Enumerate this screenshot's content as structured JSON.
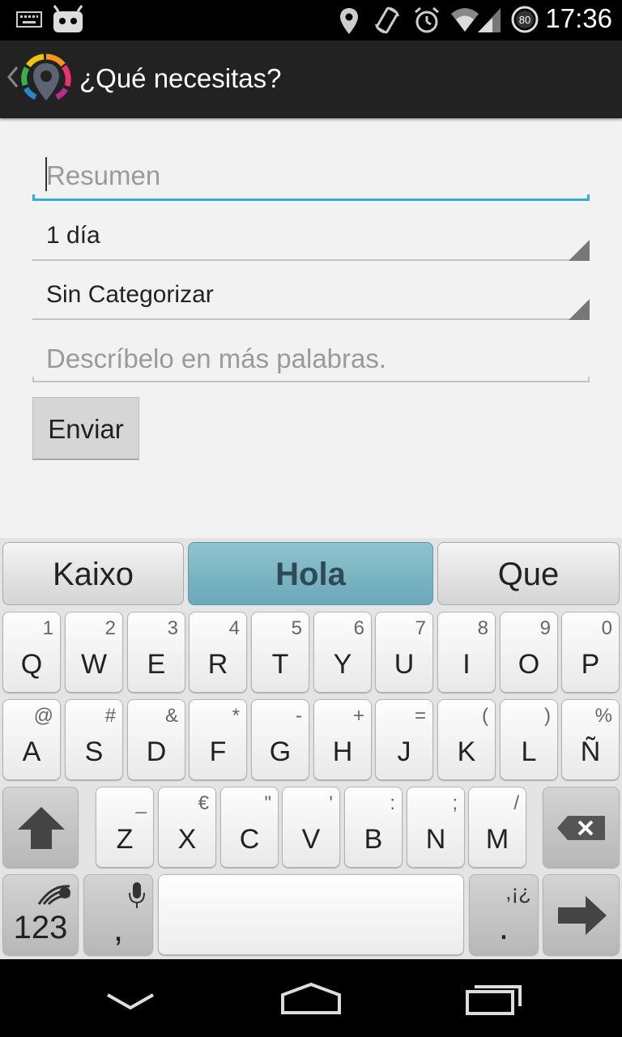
{
  "status_bar": {
    "time": "17:36",
    "battery_level": "80",
    "icons": [
      "keyboard-icon",
      "android-icon",
      "location-icon",
      "rotate-icon",
      "alarm-icon",
      "wifi-icon",
      "signal-icon",
      "battery-icon"
    ]
  },
  "action_bar": {
    "title": "¿Qué necesitas?",
    "icons": [
      "back-icon",
      "app-logo-icon"
    ]
  },
  "form": {
    "summary_placeholder": "Resumen",
    "duration_value": "1 día",
    "category_value": "Sin Categorizar",
    "description_placeholder": "Descríbelo en más palabras.",
    "submit_label": "Enviar"
  },
  "colors": {
    "accent": "#33a9d8",
    "suggestion_active": "#6aa8b8",
    "action_bar": "#222222"
  },
  "keyboard": {
    "suggestions": [
      "Kaixo",
      "Hola",
      "Que"
    ],
    "active_suggestion": "Hola",
    "row1": [
      {
        "main": "Q",
        "alt": "1"
      },
      {
        "main": "W",
        "alt": "2"
      },
      {
        "main": "E",
        "alt": "3"
      },
      {
        "main": "R",
        "alt": "4"
      },
      {
        "main": "T",
        "alt": "5"
      },
      {
        "main": "Y",
        "alt": "6"
      },
      {
        "main": "U",
        "alt": "7"
      },
      {
        "main": "I",
        "alt": "8"
      },
      {
        "main": "O",
        "alt": "9"
      },
      {
        "main": "P",
        "alt": "0"
      }
    ],
    "row2": [
      {
        "main": "A",
        "alt": "@"
      },
      {
        "main": "S",
        "alt": "#"
      },
      {
        "main": "D",
        "alt": "&"
      },
      {
        "main": "F",
        "alt": "*"
      },
      {
        "main": "G",
        "alt": "-"
      },
      {
        "main": "H",
        "alt": "+"
      },
      {
        "main": "J",
        "alt": "="
      },
      {
        "main": "K",
        "alt": "("
      },
      {
        "main": "L",
        "alt": ")"
      },
      {
        "main": "Ñ",
        "alt": "%"
      }
    ],
    "row3": [
      {
        "main": "Z",
        "alt": "_"
      },
      {
        "main": "X",
        "alt": "€"
      },
      {
        "main": "C",
        "alt": "\""
      },
      {
        "main": "V",
        "alt": "'"
      },
      {
        "main": "B",
        "alt": ":"
      },
      {
        "main": "N",
        "alt": ";"
      },
      {
        "main": "M",
        "alt": "/"
      }
    ],
    "numbers_label": "123",
    "comma_label": ",",
    "period_label": ".",
    "period_alt": ",¡¿"
  },
  "nav_bar": {
    "icons": [
      "back-icon",
      "home-icon",
      "recents-icon"
    ]
  }
}
